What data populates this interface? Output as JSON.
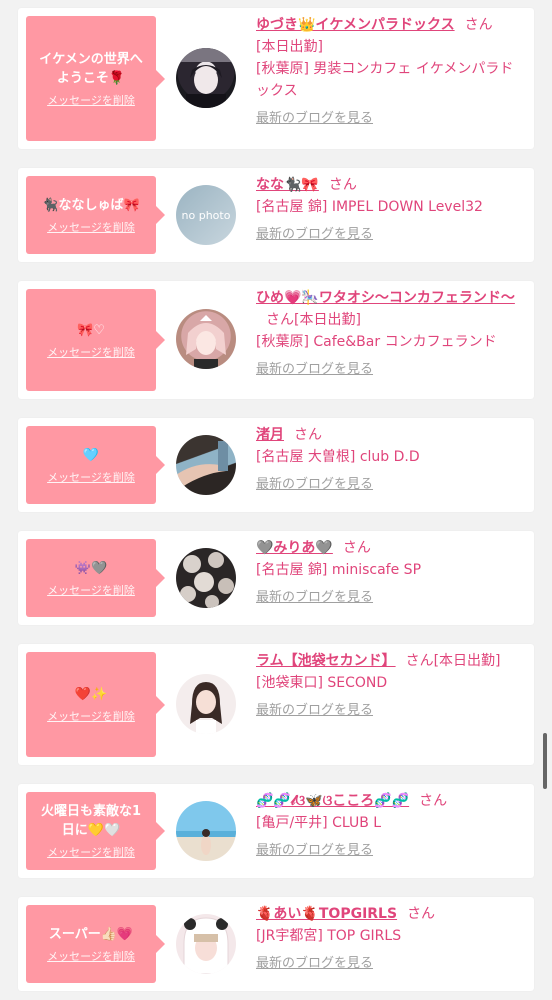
{
  "delete_label": "メッセージを削除",
  "blog_label": "最新のブログを見る",
  "san_label": "さん",
  "cards": [
    {
      "message": "イケメンの世界へ\nようこそ🌹",
      "name": "ゆづき👑イケメンパラドックス",
      "lines": [
        "[本日出勤]",
        "[秋葉原] 男装コンカフェ イケメンパラドックス"
      ],
      "avatar": "dark-hair-cosplay-photo"
    },
    {
      "message": "🐈‍⬛ななしゅば🎀",
      "name": "なな🐈‍⬛🎀",
      "lines": [
        "[名古屋 錦] IMPEL DOWN Level32"
      ],
      "avatar": "no-photo",
      "avatar_text": "no photo"
    },
    {
      "message": "🎀♡",
      "name": "ひめ💗🎠ワタオシ〜コンカフェランド〜",
      "name_suffix": "[本日出勤]",
      "lines": [
        "[秋葉原] Cafe&Bar コンカフェランド"
      ],
      "avatar": "maid-photo"
    },
    {
      "message": "🩵",
      "name": "渚月",
      "lines": [
        "[名古屋 大曽根] club D.D"
      ],
      "avatar": "arm-photo"
    },
    {
      "message": "👾🩶",
      "name": "🩶みりあ🩶",
      "lines": [
        "[名古屋 錦] miniscafe SP"
      ],
      "avatar": "pattern-photo"
    },
    {
      "message": "❤️✨",
      "name": "ラム【池袋セカンド】",
      "name_suffix": "[本日出勤]",
      "lines": [
        "[池袋東口] SECOND"
      ],
      "avatar": "girl-photo"
    },
    {
      "message": "火曜日も素敵な1\n日に💛🤍",
      "name": "🧬🧬𝓁ଓ🦋ଓこころ🧬🧬",
      "lines": [
        "[亀戸/平井] CLUB L"
      ],
      "avatar": "beach-photo"
    },
    {
      "message": "スーパー👍🏻💗",
      "name": "🫀あい🫀TOPGIRLS",
      "lines": [
        "[JR宇都宮] TOP GIRLS"
      ],
      "avatar": "panda-hood-photo"
    }
  ]
}
